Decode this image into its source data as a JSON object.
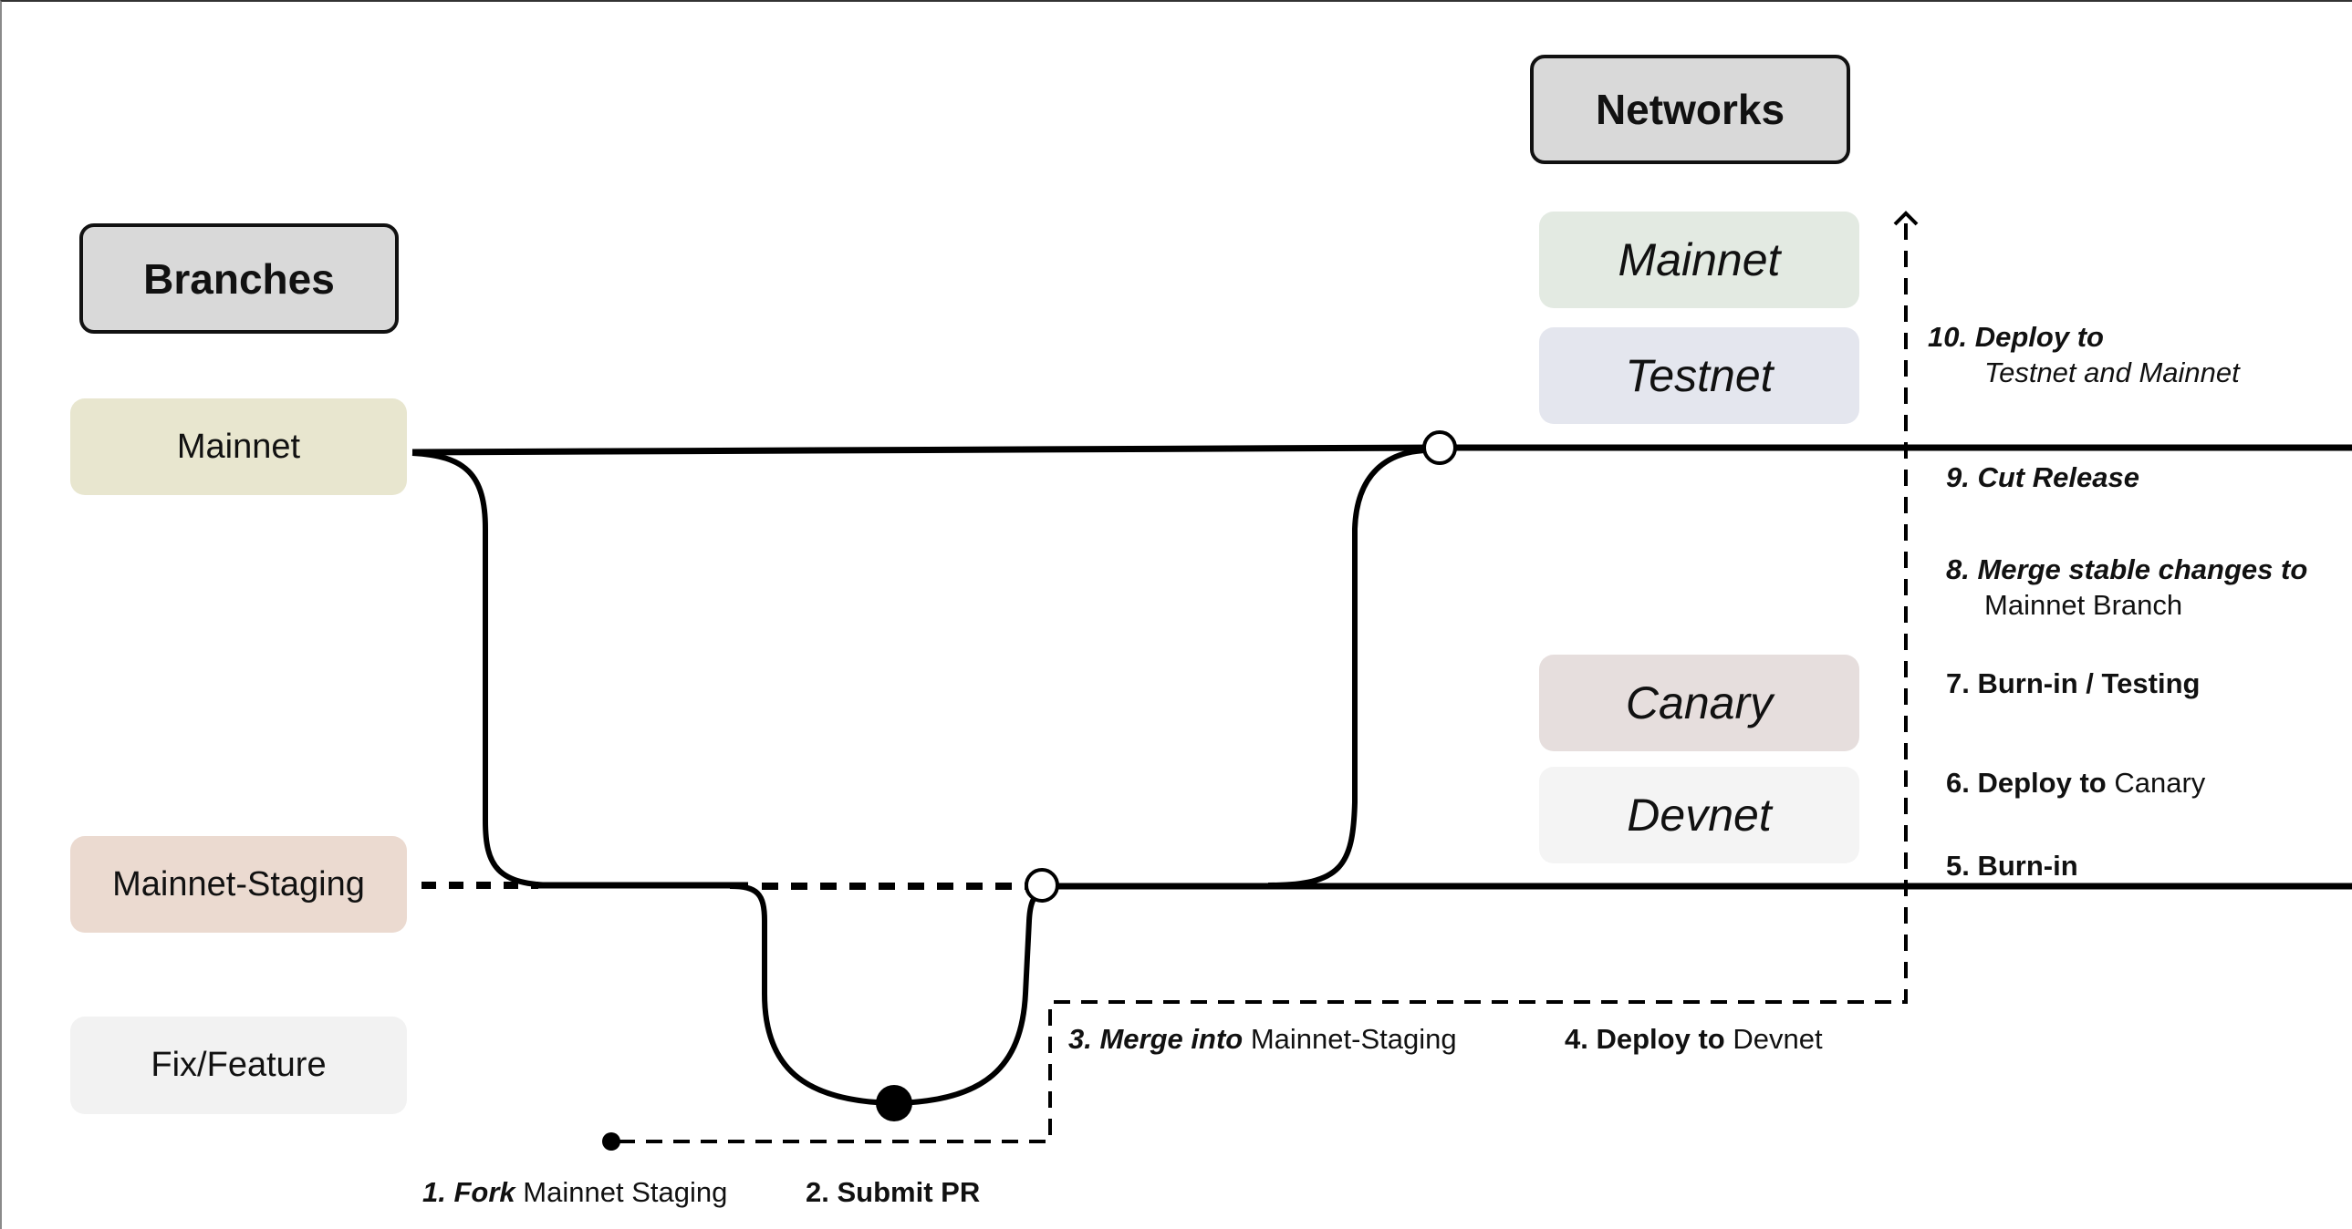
{
  "headers": {
    "branches": "Branches",
    "networks": "Networks"
  },
  "branches": [
    {
      "id": "mainnet",
      "label": "Mainnet",
      "color": "#e8e6cf"
    },
    {
      "id": "mainnet-staging",
      "label": "Mainnet-Staging",
      "color": "#ebdad0"
    },
    {
      "id": "fix-feature",
      "label": "Fix/Feature",
      "color": "#f2f2f2"
    }
  ],
  "networks": [
    {
      "id": "mainnet",
      "label": "Mainnet",
      "color": "#e3eae2"
    },
    {
      "id": "testnet",
      "label": "Testnet",
      "color": "#e4e6ee"
    },
    {
      "id": "canary",
      "label": "Canary",
      "color": "#e6dedd"
    },
    {
      "id": "devnet",
      "label": "Devnet",
      "color": "#f4f4f4"
    }
  ],
  "steps": {
    "s1": {
      "num": "1.",
      "action": "Fork",
      "target": "Mainnet Staging"
    },
    "s2": {
      "num": "2.",
      "action": "Submit PR"
    },
    "s3": {
      "num": "3.",
      "action": "Merge into",
      "target": "Mainnet-Staging"
    },
    "s4": {
      "num": "4.",
      "action": "Deploy to",
      "target": "Devnet"
    },
    "s5": {
      "num": "5.",
      "action": "Burn-in"
    },
    "s6": {
      "num": "6.",
      "action": "Deploy to",
      "target": "Canary"
    },
    "s7": {
      "num": "7.",
      "action": "Burn-in / Testing"
    },
    "s8": {
      "num": "8.",
      "action": "Merge stable changes to",
      "target": "Mainnet Branch"
    },
    "s9": {
      "num": "9.",
      "action": "Cut Release"
    },
    "s10": {
      "num": "10.",
      "action": "Deploy to",
      "target": "Testnet and Mainnet"
    }
  }
}
